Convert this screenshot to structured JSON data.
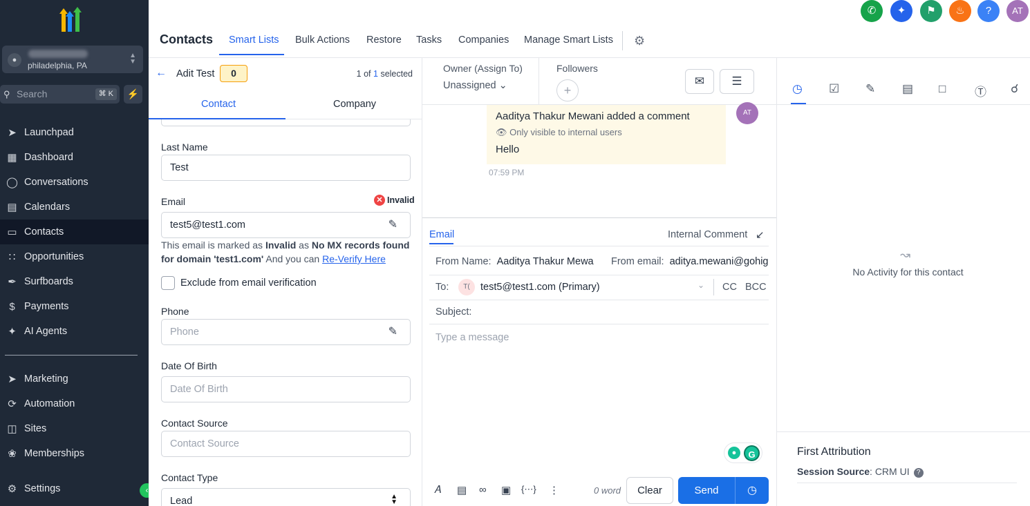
{
  "sidebar": {
    "location": "philadelphia, PA",
    "search_placeholder": "Search",
    "search_shortcut": "⌘ K",
    "nav": [
      {
        "label": "Launchpad",
        "icon": "rocket-icon"
      },
      {
        "label": "Dashboard",
        "icon": "grid-icon"
      },
      {
        "label": "Conversations",
        "icon": "chat-icon"
      },
      {
        "label": "Calendars",
        "icon": "calendar-icon"
      },
      {
        "label": "Contacts",
        "icon": "contacts-icon"
      },
      {
        "label": "Opportunities",
        "icon": "funnel-icon"
      },
      {
        "label": "Surfboards",
        "icon": "surfboard-icon"
      },
      {
        "label": "Payments",
        "icon": "dollar-icon"
      },
      {
        "label": "AI Agents",
        "icon": "sparkle-icon"
      }
    ],
    "nav2": [
      {
        "label": "Marketing",
        "icon": "send-icon"
      },
      {
        "label": "Automation",
        "icon": "automation-icon"
      },
      {
        "label": "Sites",
        "icon": "globe-icon"
      },
      {
        "label": "Memberships",
        "icon": "award-icon"
      }
    ],
    "settings": "Settings"
  },
  "header": {
    "title": "Contacts",
    "tabs": [
      "Smart Lists",
      "Bulk Actions",
      "Restore",
      "Tasks",
      "Companies",
      "Manage Smart Lists"
    ],
    "avatar_initials": "AT"
  },
  "contact_panel": {
    "name": "Adit Test",
    "badge": "0",
    "pager_prefix": "1 of",
    "pager_count": "1",
    "pager_suffix": "selected",
    "tabs": [
      "Contact",
      "Company"
    ],
    "last_name_label": "Last Name",
    "last_name_value": "Test",
    "email_label": "Email",
    "email_status": "Invalid",
    "email_value": "test5@test1.com",
    "note_1": "This email is marked as ",
    "note_invalid": "Invalid",
    "note_2": " as ",
    "note_reason": "No MX records found for domain 'test1.com'",
    "note_3": " And you can ",
    "note_link": "Re-Verify Here",
    "exclude_label": "Exclude from email verification",
    "phone_label": "Phone",
    "phone_placeholder": "Phone",
    "dob_label": "Date Of Birth",
    "dob_placeholder": "Date Of Birth",
    "source_label": "Contact Source",
    "source_placeholder": "Contact Source",
    "type_label": "Contact Type",
    "type_value": "Lead"
  },
  "conversation": {
    "owner_label": "Owner (Assign To)",
    "owner_value": "Unassigned",
    "followers_label": "Followers",
    "comment_author": "Aaditya Thakur Mewani added a comment",
    "comment_visibility": "Only visible to internal users",
    "comment_text": "Hello",
    "comment_avatar": "AT",
    "comment_time": "07:59 PM",
    "tab_email": "Email",
    "tab_internal": "Internal Comment",
    "from_name_label": "From Name:",
    "from_name_value": "Aaditya Thakur Mewa",
    "from_email_label": "From email:",
    "from_email_value": "aditya.mewani@gohig",
    "to_label": "To:",
    "to_avatar": "T(",
    "to_value": "test5@test1.com (Primary)",
    "cc": "CC",
    "bcc": "BCC",
    "subject_label": "Subject:",
    "message_placeholder": "Type a message",
    "word_count": "0 word",
    "clear": "Clear",
    "send": "Send"
  },
  "activity": {
    "empty": "No Activity for this contact",
    "attribution_title": "First Attribution",
    "session_source_label": "Session Source",
    "session_source_value": ": CRM UI"
  }
}
